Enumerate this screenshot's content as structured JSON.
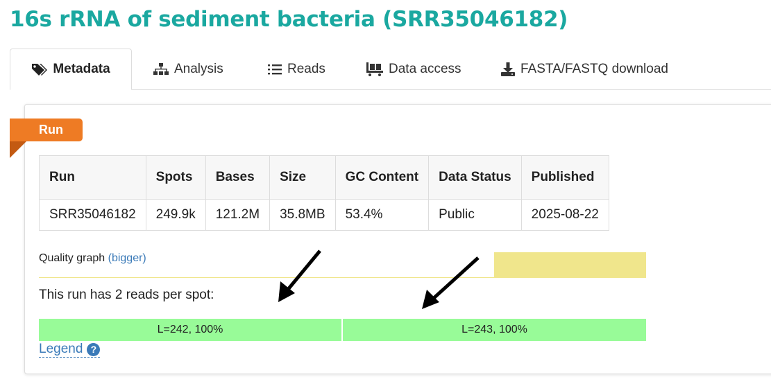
{
  "page": {
    "title": "16s rRNA of sediment bacteria (SRR35046182)"
  },
  "tabs": [
    {
      "label": "Metadata",
      "icon": "tags-icon",
      "active": true
    },
    {
      "label": "Analysis",
      "icon": "sitemap-icon",
      "active": false
    },
    {
      "label": "Reads",
      "icon": "list-icon",
      "active": false
    },
    {
      "label": "Data access",
      "icon": "pallet-icon",
      "active": false
    },
    {
      "label": "FASTA/FASTQ download",
      "icon": "download-icon",
      "active": false
    }
  ],
  "panel": {
    "ribbon_label": "Run",
    "table": {
      "headers": [
        "Run",
        "Spots",
        "Bases",
        "Size",
        "GC Content",
        "Data Status",
        "Published"
      ],
      "rows": [
        [
          "SRR35046182",
          "249.9k",
          "121.2M",
          "35.8MB",
          "53.4%",
          "Public",
          "2025-08-22"
        ]
      ]
    },
    "quality_graph": {
      "label": "Quality graph",
      "link": "(bigger)"
    },
    "reads_per_spot_text": "This run has 2 reads per spot:",
    "reads": [
      {
        "label": "L=242, 100%",
        "color": "#98fb98"
      },
      {
        "label": "L=243, 100%",
        "color": "#98fb98"
      }
    ],
    "legend_link": "Legend",
    "legend_help_glyph": "?"
  },
  "colors": {
    "title": "#1aa8a0",
    "ribbon": "#ee7b24",
    "link": "#3a7ab8",
    "quality_bar": "#f0e68c",
    "read_bar": "#98fb98"
  }
}
